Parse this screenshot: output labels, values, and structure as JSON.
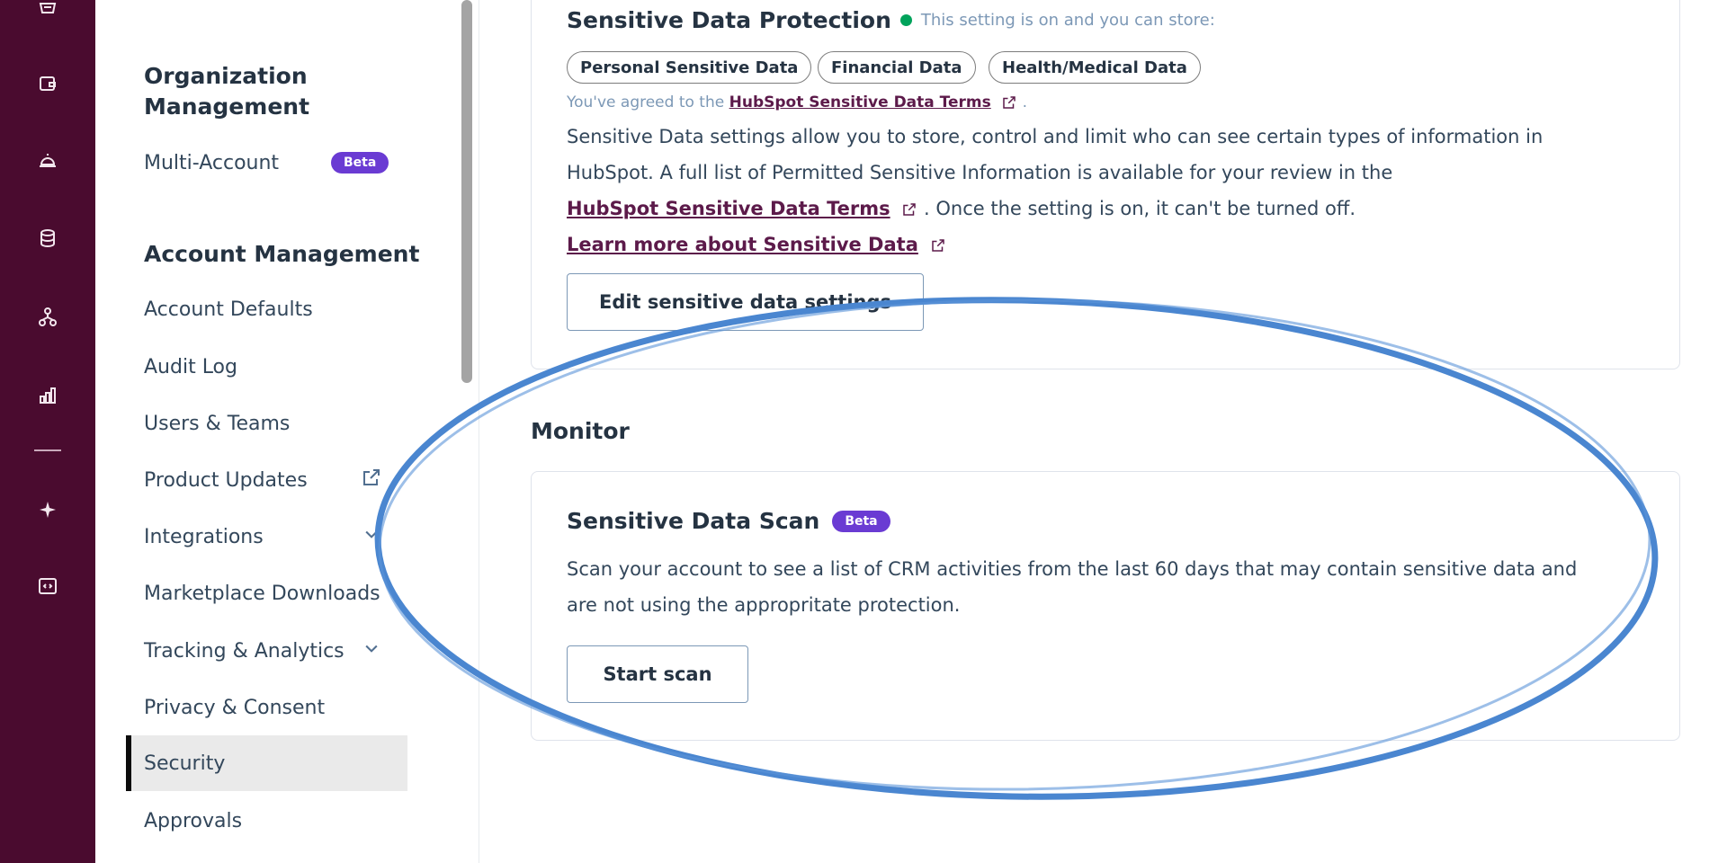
{
  "sidebar": {
    "org_title": "Organization Management",
    "multi_account_label": "Multi-Account",
    "beta_label": "Beta",
    "account_title": "Account Management",
    "items": [
      {
        "label": "Account Defaults",
        "trail": ""
      },
      {
        "label": "Audit Log",
        "trail": ""
      },
      {
        "label": "Users & Teams",
        "trail": ""
      },
      {
        "label": "Product Updates",
        "trail": "external-link-icon"
      },
      {
        "label": "Integrations",
        "trail": "chevron-down-icon"
      },
      {
        "label": "Marketplace Downloads",
        "trail": ""
      },
      {
        "label": "Tracking & Analytics",
        "trail": "chevron-down-icon"
      },
      {
        "label": "Privacy & Consent",
        "trail": ""
      },
      {
        "label": "Security",
        "trail": "",
        "active": true
      },
      {
        "label": "Approvals",
        "trail": ""
      }
    ]
  },
  "rail_icons": [
    "basket-icon",
    "wallet-icon",
    "service-bell-icon",
    "database-icon",
    "org-chart-icon",
    "bar-chart-icon",
    "sparkle-icon",
    "code-icon"
  ],
  "protection": {
    "title": "Sensitive Data Protection",
    "status_text": "This setting is on and you can store:",
    "chips": [
      "Personal Sensitive Data",
      "Financial Data",
      "Health/Medical Data"
    ],
    "agreed_prefix": "You've agreed to the",
    "terms_link": "HubSpot Sensitive Data Terms",
    "agreed_suffix": ".",
    "desc_line1": "Sensitive Data settings allow you to store, control and limit who can see certain types of information in",
    "desc_line2": "HubSpot. A full list of Permitted Sensitive Information is available for your review in the",
    "desc_line3_link": "HubSpot Sensitive Data Terms",
    "desc_line3_rest": ". Once the setting is on, it can't be turned off.",
    "learn_more": "Learn more about Sensitive Data",
    "edit_button": "Edit sensitive data settings"
  },
  "monitor": {
    "heading": "Monitor",
    "scan_title": "Sensitive Data Scan",
    "beta_label": "Beta",
    "scan_desc1": "Scan your account to see a list of CRM activities from the last 60 days that may contain sensitive data and",
    "scan_desc2": "are not using the appropritate protection.",
    "start_button": "Start scan"
  },
  "colors": {
    "rail": "#4a0b2f",
    "beta": "#6a3bd3",
    "status_dot": "#00a35b",
    "annotation": "#4a86d0",
    "link": "#5c1a4a"
  }
}
